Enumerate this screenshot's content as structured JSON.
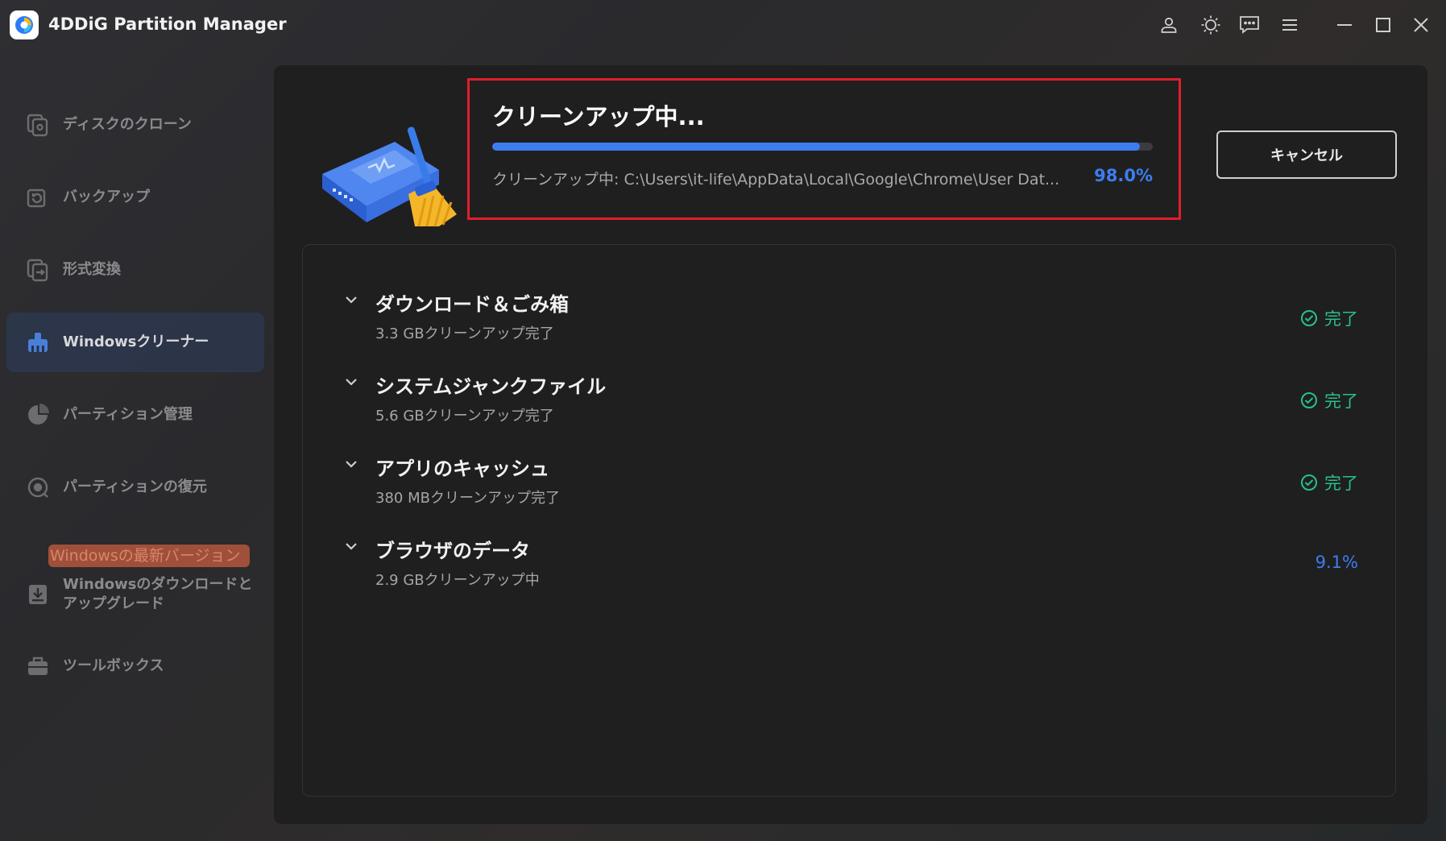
{
  "window": {
    "title": "4DDiG Partition Manager",
    "icons": [
      "account-icon",
      "theme-sun-icon",
      "feedback-icon",
      "menu-icon",
      "minimize-icon",
      "maximize-icon",
      "close-icon"
    ]
  },
  "sidebar": {
    "items": [
      {
        "label": "ディスクのクローン",
        "icon": "disk-clone-icon"
      },
      {
        "label": "バックアップ",
        "icon": "backup-icon"
      },
      {
        "label": "形式変換",
        "icon": "format-convert-icon"
      },
      {
        "label": "Windowsクリーナー",
        "icon": "cleaner-icon",
        "active": true
      },
      {
        "label": "パーティション管理",
        "icon": "pie-chart-icon"
      },
      {
        "label": "パーティションの復元",
        "icon": "partition-recovery-icon"
      },
      {
        "label": "Windowsのダウンロードとアップグレード",
        "icon": "windows-download-icon"
      },
      {
        "label": "ツールボックス",
        "icon": "toolbox-icon"
      }
    ],
    "promo_badge": "Windowsの最新バージョン"
  },
  "progress": {
    "title": "クリーンアップ中...",
    "path_text": "クリーンアップ中:  C:\\Users\\it-life\\AppData\\Local\\Google\\Chrome\\User Dat...",
    "percent_text": "98.0%",
    "percent_value": 0.98,
    "cancel_label": "キャンセル"
  },
  "categories": [
    {
      "title": "ダウンロード＆ごみ箱",
      "subtitle": "3.3 GBクリーンアップ完了",
      "status": "完了",
      "done": true
    },
    {
      "title": "システムジャンクファイル",
      "subtitle": "5.6 GBクリーンアップ完了",
      "status": "完了",
      "done": true
    },
    {
      "title": "アプリのキャッシュ",
      "subtitle": "380 MBクリーンアップ完了",
      "status": "完了",
      "done": true
    },
    {
      "title": "ブラウザのデータ",
      "subtitle": "2.9 GBクリーンアップ中",
      "status": "9.1%",
      "done": false
    }
  ],
  "colors": {
    "accent": "#3d7df0",
    "success": "#29c08a",
    "highlight_border": "#e01e2a"
  }
}
